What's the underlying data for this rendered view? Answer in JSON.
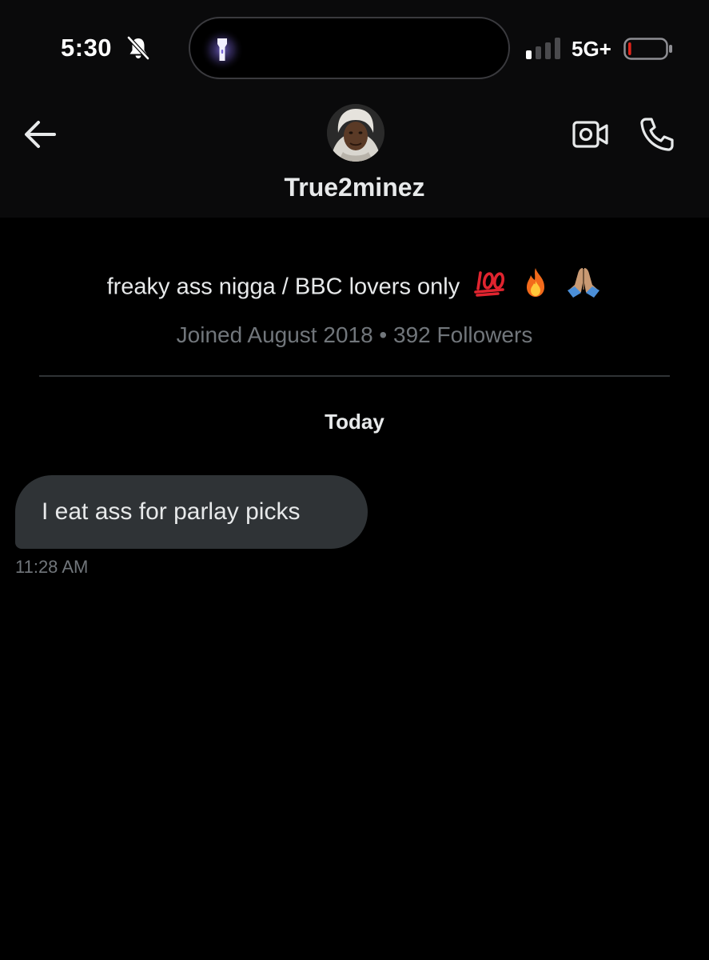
{
  "status_bar": {
    "time": "5:30",
    "network": "5G+",
    "icons": [
      "bell-slash-icon",
      "flashlight-icon",
      "signal-icon",
      "battery-icon"
    ],
    "battery_level": 0.08,
    "signal_bars": 1
  },
  "header": {
    "name": "True2minez",
    "icons": [
      "back-arrow-icon",
      "video-call-icon",
      "phone-icon"
    ]
  },
  "profile": {
    "bio": "freaky ass nigga / BBC lovers only",
    "bio_emoji": [
      "💯",
      "🔥",
      "🙏🏽"
    ],
    "meta": "Joined August 2018 • 392 Followers"
  },
  "conversation": {
    "day_label": "Today",
    "messages": [
      {
        "text": "I eat ass for parlay picks",
        "time": "11:28 AM"
      }
    ]
  },
  "colors": {
    "background": "#000000",
    "header_background": "#0a0a0b",
    "bubble": "#2f3336",
    "secondary_text": "#71767b",
    "battery_low": "#e0241b"
  }
}
